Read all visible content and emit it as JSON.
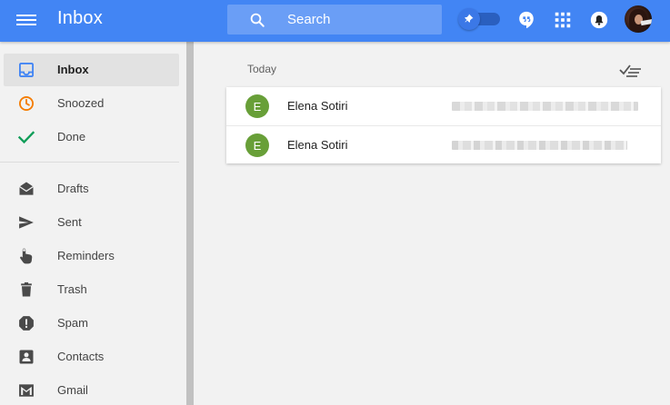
{
  "header": {
    "title": "Inbox",
    "search_placeholder": "Search",
    "icons": [
      "menu-icon",
      "search-icon",
      "pin-icon",
      "hangouts-icon",
      "apps-grid-icon",
      "notifications-bell-icon",
      "avatar"
    ]
  },
  "sidebar": {
    "items": [
      {
        "label": "Inbox",
        "icon": "inbox-icon",
        "active": true
      },
      {
        "label": "Snoozed",
        "icon": "clock-icon"
      },
      {
        "label": "Done",
        "icon": "checkmark-icon"
      },
      {
        "label": "Drafts",
        "icon": "drafts-icon"
      },
      {
        "label": "Sent",
        "icon": "send-icon"
      },
      {
        "label": "Reminders",
        "icon": "reminder-hand-icon"
      },
      {
        "label": "Trash",
        "icon": "trash-icon"
      },
      {
        "label": "Spam",
        "icon": "spam-icon"
      },
      {
        "label": "Contacts",
        "icon": "contacts-icon"
      },
      {
        "label": "Gmail",
        "icon": "gmail-icon"
      }
    ]
  },
  "main": {
    "section_label": "Today",
    "messages": [
      {
        "avatar_letter": "E",
        "sender": "Elena Sotiri"
      },
      {
        "avatar_letter": "E",
        "sender": "Elena Sotiri"
      }
    ]
  },
  "colors": {
    "brand_blue": "#4285f4",
    "avatar_green": "#689f38",
    "snoozed_orange": "#f57c00",
    "done_green": "#0f9d58"
  }
}
